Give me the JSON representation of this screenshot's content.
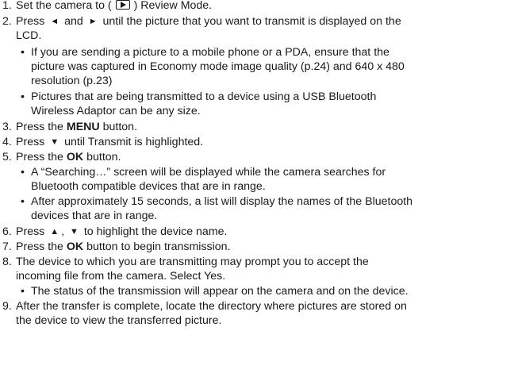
{
  "steps": {
    "s1": {
      "num": "1.",
      "before": "Set the camera to (",
      "icon": "review-mode-icon",
      "after": ") Review Mode."
    },
    "s2": {
      "num": "2.",
      "press": "Press",
      "left": "◄",
      "and": "and",
      "right": "►",
      "rest": "until the picture that you want to transmit is displayed on the",
      "cont": "LCD.",
      "b1_l1": "If you are sending a picture to a mobile phone or a PDA, ensure that the",
      "b1_l2": "picture was captured in Economy mode image quality (p.24) and 640 x 480",
      "b1_l3": "resolution (p.23)",
      "b2_l1": "Pictures that are being transmitted to a device using a USB Bluetooth",
      "b2_l2": "Wireless Adaptor can be any size."
    },
    "s3": {
      "num": "3.",
      "pre": "Press the",
      "bold": "MENU",
      "post": "button."
    },
    "s4": {
      "num": "4.",
      "pre": "Press",
      "down": "▼",
      "post": "until Transmit is highlighted."
    },
    "s5": {
      "num": "5.",
      "pre": "Press the",
      "bold": "OK",
      "post": "button.",
      "b1_l1": "A “Searching…” screen will be displayed while the camera searches for",
      "b1_l2": "Bluetooth compatible devices that are in range.",
      "b2_l1": "After approximately 15 seconds, a list will display the names of the Bluetooth",
      "b2_l2": "devices that are in range."
    },
    "s6": {
      "num": "6.",
      "pre": "Press",
      "up": "▲",
      "comma": ",",
      "down": "▼",
      "post": "to highlight the device name."
    },
    "s7": {
      "num": "7.",
      "pre": "Press the",
      "bold": "OK",
      "post": "button to begin transmission."
    },
    "s8": {
      "num": "8.",
      "l1": "The device to which you are transmitting may prompt you to accept the",
      "l2": "incoming file from the camera.  Select Yes.",
      "b1": "The status of the transmission will appear on the camera and on the device."
    },
    "s9": {
      "num": "9.",
      "l1": "After the transfer is complete, locate the directory where pictures are stored on",
      "l2": "the device to view the transferred picture."
    }
  },
  "bullet_char": "•"
}
